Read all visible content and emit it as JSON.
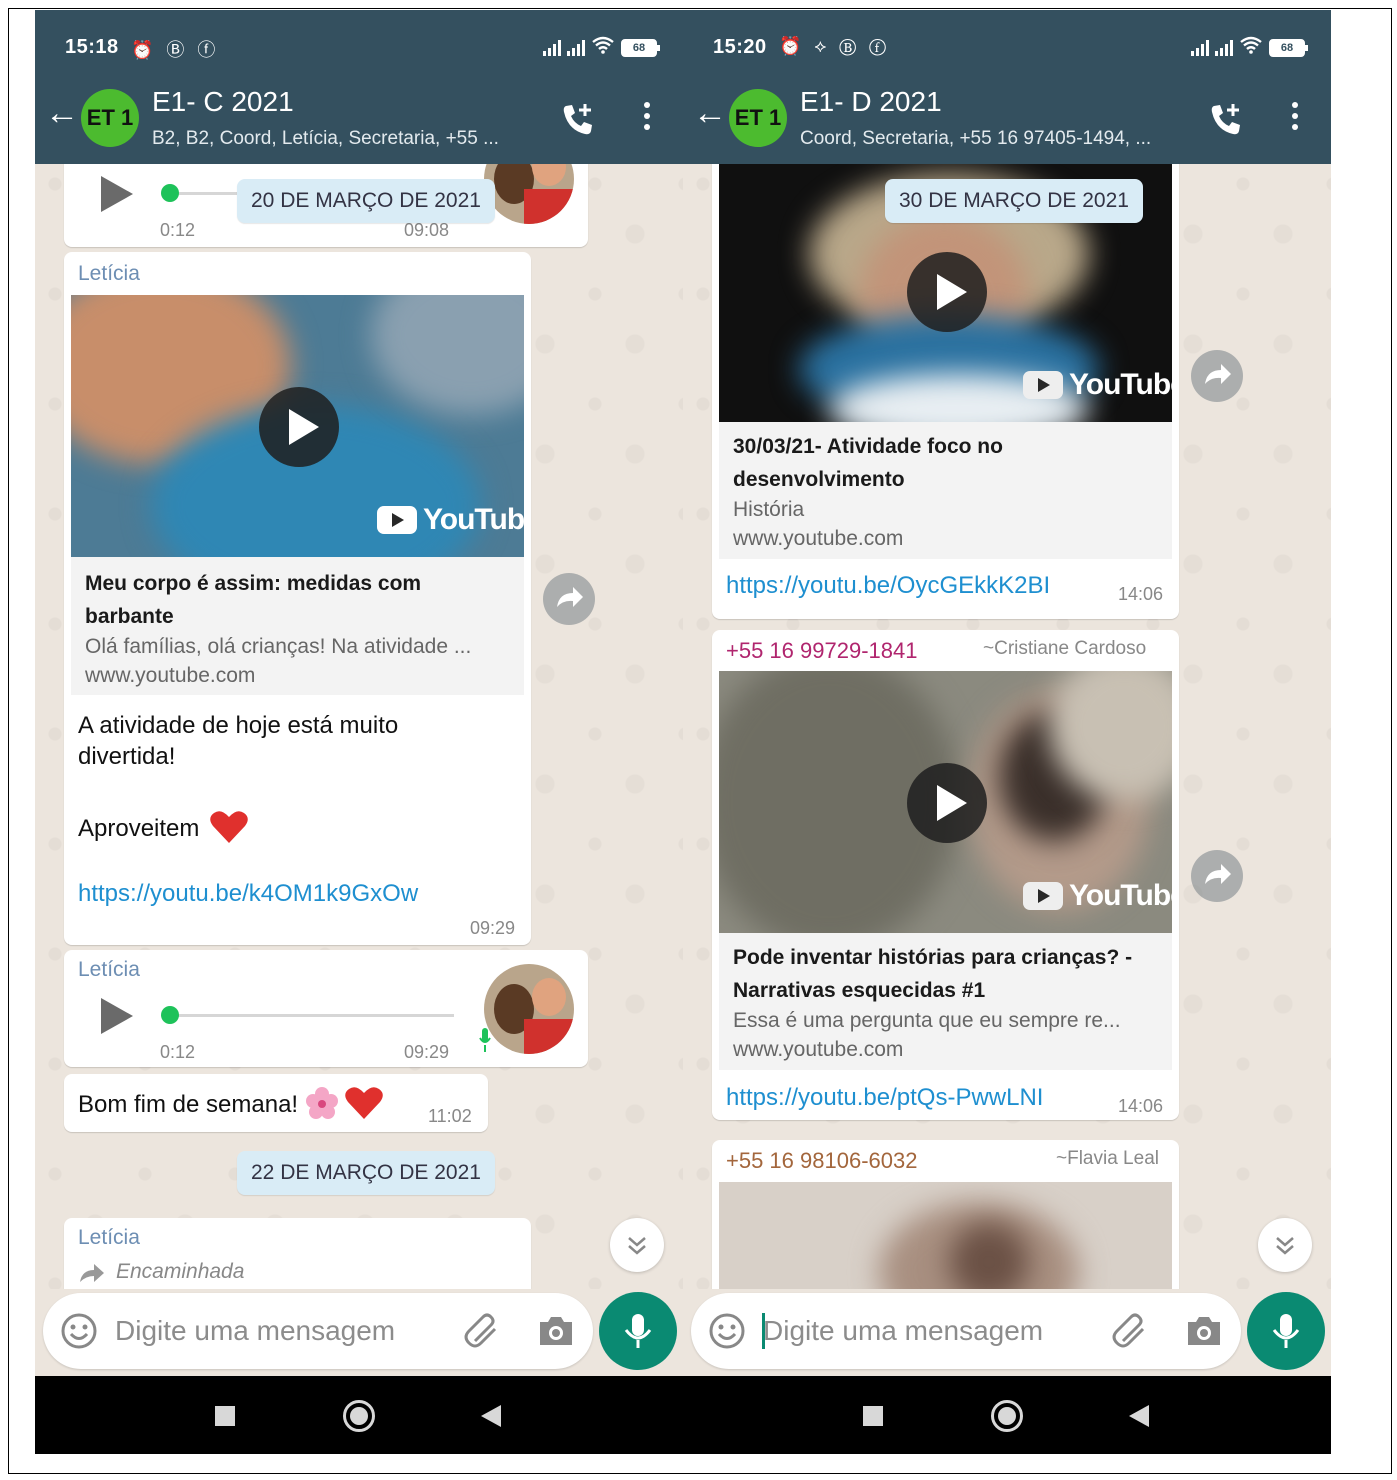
{
  "left": {
    "status_time": "15:18",
    "status_icons": "⏰ Ⓑ ⓕ",
    "battery": "68",
    "chat_title": "E1- C 2021",
    "chat_subtitle": "B2, B2, Coord, Letícia, Secretaria, +55 ...",
    "avatar_text": "ET 1",
    "voice1": {
      "duration": "0:12",
      "time": "09:08"
    },
    "date1": "20 DE MARÇO DE 2021",
    "msg1": {
      "sender": "Letícia",
      "yt_label": "YouTube",
      "title": "Meu corpo é assim: medidas com barbante",
      "desc": "Olá famílias, olá crianças! Na atividade ...",
      "url": "www.youtube.com",
      "text_line1": "A atividade de hoje está muito",
      "text_line2": "divertida!",
      "text_line3": "Aproveitem",
      "link": "https://youtu.be/k4OM1k9GxOw",
      "time": "09:29"
    },
    "voice2": {
      "sender": "Letícia",
      "duration": "0:12",
      "time": "09:29"
    },
    "msg2": {
      "text": "Bom fim de semana!",
      "time": "11:02"
    },
    "date2": "22 DE MARÇO DE 2021",
    "msg3": {
      "sender": "Letícia",
      "forwarded": "Encaminhada"
    },
    "input_placeholder": "Digite uma mensagem"
  },
  "right": {
    "status_time": "15:20",
    "status_icons": "⏰ ⟡ Ⓑ ⓕ",
    "battery": "68",
    "chat_title": "E1- D 2021",
    "chat_subtitle": "Coord, Secretaria, +55 16 97405-1494, ...",
    "avatar_text": "ET 1",
    "date1": "30 DE MARÇO DE 2021",
    "msg1": {
      "yt_label": "YouTube",
      "title": "30/03/21- Atividade foco no desenvolvimento",
      "desc": "História",
      "url": "www.youtube.com",
      "link": "https://youtu.be/OycGEkkK2BI",
      "time": "14:06"
    },
    "msg2": {
      "phone": "+55 16 99729-1841",
      "name": "~Cristiane Cardoso",
      "yt_label": "YouTube",
      "title": "Pode inventar histórias para crianças? - Narrativas esquecidas #1",
      "desc": "Essa é uma pergunta que eu sempre re...",
      "url": "www.youtube.com",
      "link": "https://youtu.be/ptQs-PwwLNI",
      "time": "14:06"
    },
    "msg3": {
      "phone": "+55 16 98106-6032",
      "name": "~Flavia Leal"
    },
    "input_placeholder": "Digite uma mensagem"
  },
  "colors": {
    "header": "#34505f",
    "chat_bg": "#ece5dd",
    "sender_name": "#6d8eb3",
    "link": "#1e8fd0",
    "mic_button": "#0a8a72",
    "date_pill": "#d9ecf6",
    "phone_magenta": "#b0256e",
    "phone_brown": "#a3663c"
  }
}
